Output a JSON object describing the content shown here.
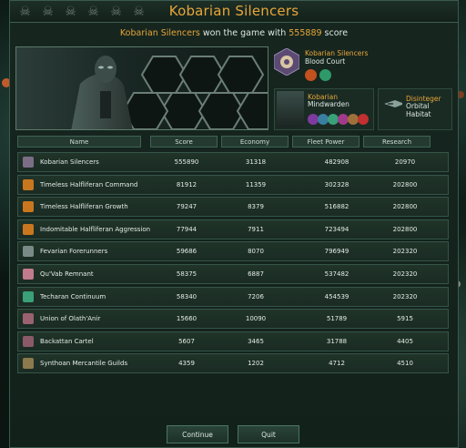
{
  "window": {
    "title": "Kobarian Silencers",
    "subtitle_empire": "Kobarian Silencers",
    "subtitle_middle": " won the game with ",
    "subtitle_score": "555889",
    "subtitle_end": " score"
  },
  "skull_count": 6,
  "empire_card": {
    "name": "Kobarian Silencers",
    "government": "Blood Court"
  },
  "leader_card": {
    "name": "Kobarian",
    "title": "Mindwarden"
  },
  "ship_card": {
    "name": "Disinteger",
    "type": "Orbital Habitat"
  },
  "table": {
    "columns": [
      "Name",
      "Score",
      "Economy",
      "Fleet Power",
      "Research"
    ],
    "rows": [
      {
        "name": "Kobarian Silencers",
        "score": "555890",
        "economy": "31318",
        "fleet": "482908",
        "research": "20970",
        "icon_color": "#7b6d86"
      },
      {
        "name": "Timeless Halfliferan Command",
        "score": "81912",
        "economy": "11359",
        "fleet": "302328",
        "research": "202800",
        "icon_color": "#c9771e"
      },
      {
        "name": "Timeless Halfliferan Growth",
        "score": "79247",
        "economy": "8379",
        "fleet": "516882",
        "research": "202800",
        "icon_color": "#c9771e"
      },
      {
        "name": "Indomitable Halfliferan Aggression",
        "score": "77944",
        "economy": "7911",
        "fleet": "723494",
        "research": "202800",
        "icon_color": "#c9771e"
      },
      {
        "name": "Fevarian Forerunners",
        "score": "59686",
        "economy": "8070",
        "fleet": "796949",
        "research": "202320",
        "icon_color": "#7a8a86"
      },
      {
        "name": "Qu'Vab Remnant",
        "score": "58375",
        "economy": "6887",
        "fleet": "537482",
        "research": "202320",
        "icon_color": "#c07b8c"
      },
      {
        "name": "Techaran Continuum",
        "score": "58340",
        "economy": "7206",
        "fleet": "454539",
        "research": "202320",
        "icon_color": "#3aa078"
      },
      {
        "name": "Union of Olath'Anir",
        "score": "15660",
        "economy": "10090",
        "fleet": "51789",
        "research": "5915",
        "icon_color": "#9a6270"
      },
      {
        "name": "Backattan Cartel",
        "score": "5607",
        "economy": "3465",
        "fleet": "31788",
        "research": "4405",
        "icon_color": "#8a5a68"
      },
      {
        "name": "Synthoan Mercantile Guilds",
        "score": "4359",
        "economy": "1202",
        "fleet": "4712",
        "research": "4510",
        "icon_color": "#8a7a4e"
      }
    ]
  },
  "buttons": {
    "continue": "Continue",
    "quit": "Quit"
  },
  "colors": {
    "accent": "#e8a53a",
    "panel": "#16261f",
    "border": "#3b5a4d"
  },
  "icons": {
    "header": "skull-icon",
    "emblem": "empire-emblem-icon",
    "ship": "starship-icon"
  }
}
